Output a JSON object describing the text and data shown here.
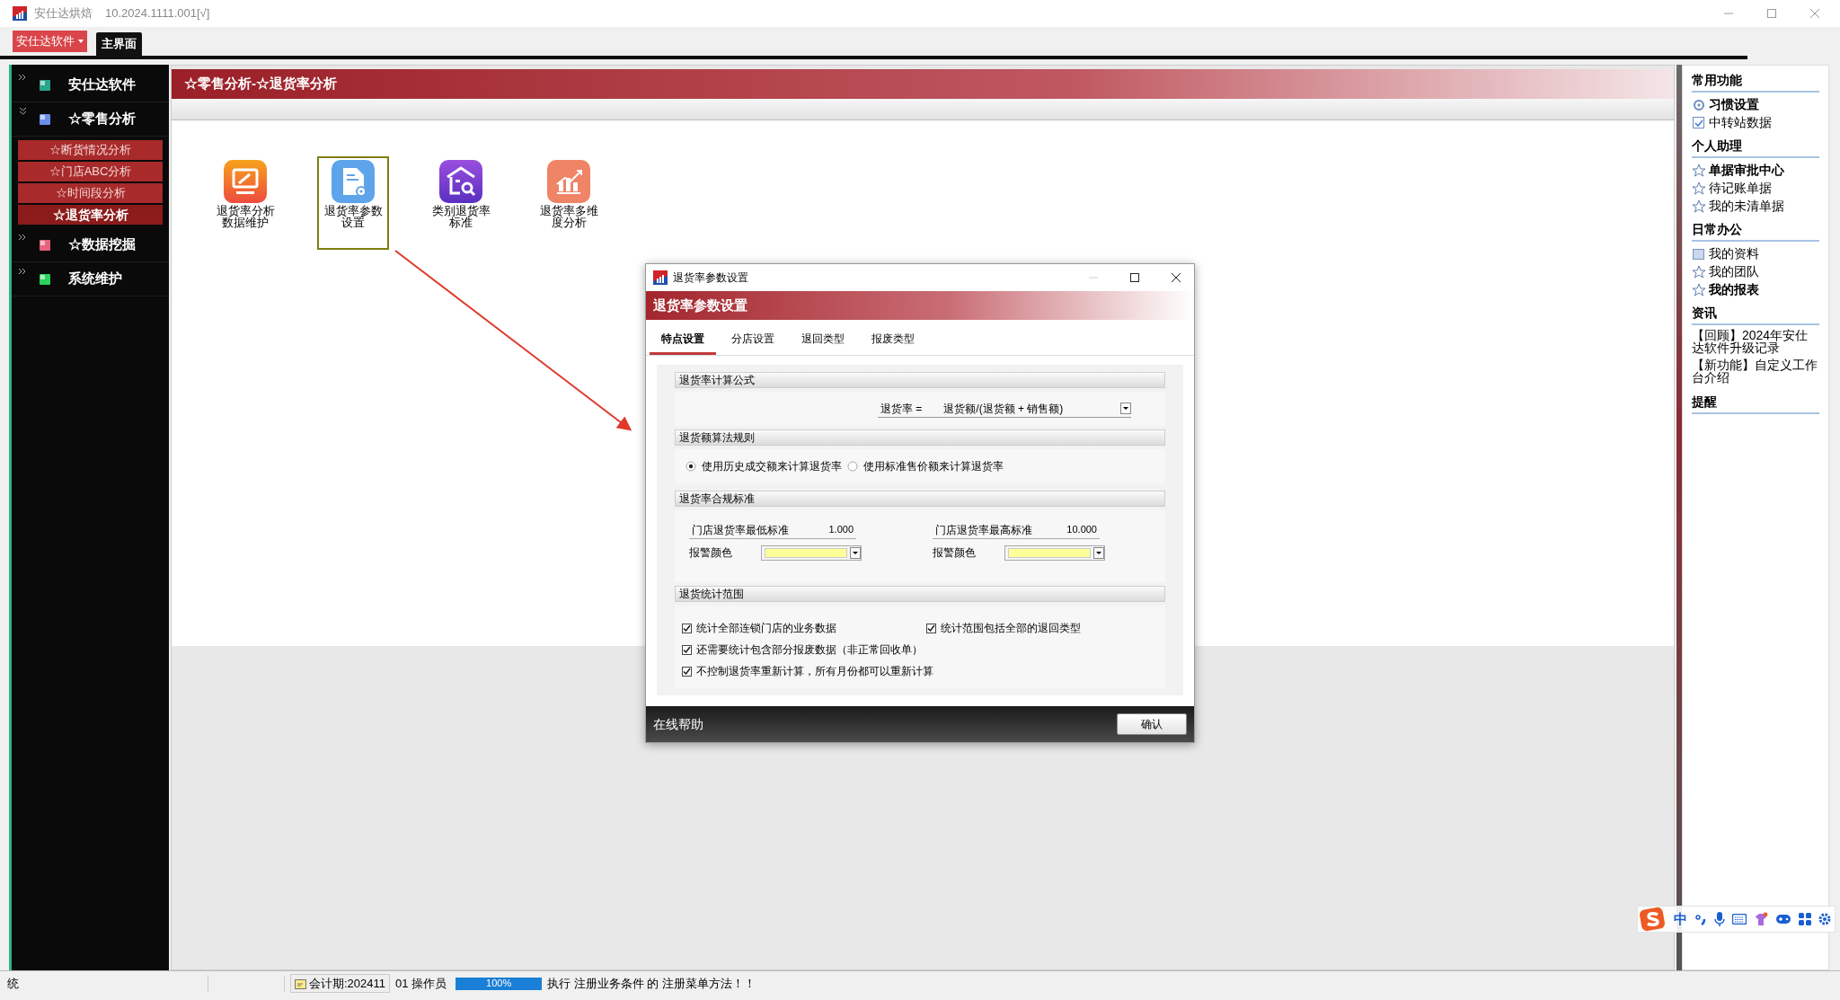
{
  "window": {
    "title": "安仕达烘焙",
    "version": "10.2024.1111.001[√]"
  },
  "menu_button": {
    "label": "安仕达软件"
  },
  "tabs": [
    {
      "label": "主界面",
      "selected": true
    }
  ],
  "sidebar": {
    "groups": [
      {
        "label": "安仕达软件",
        "expanded": false
      },
      {
        "label": "☆零售分析",
        "expanded": true,
        "children": [
          {
            "label": "☆断货情况分析",
            "selected": false
          },
          {
            "label": "☆门店ABC分析",
            "selected": false
          },
          {
            "label": "☆时间段分析",
            "selected": false
          },
          {
            "label": "☆退货率分析",
            "selected": true
          }
        ]
      },
      {
        "label": "☆数据挖掘",
        "expanded": false
      },
      {
        "label": "系统维护",
        "expanded": false
      }
    ]
  },
  "breadcrumb": "☆零售分析-☆退货率分析",
  "launchers": [
    {
      "lines": [
        "退货率分析",
        "数据维护"
      ],
      "selected": false
    },
    {
      "lines": [
        "退货率参数",
        "设置"
      ],
      "selected": true
    },
    {
      "lines": [
        "类别退货率",
        "标准"
      ],
      "selected": false
    },
    {
      "lines": [
        "退货率多维",
        "度分析"
      ],
      "selected": false
    }
  ],
  "dialog": {
    "title": "退货率参数设置",
    "header": "退货率参数设置",
    "tabs": [
      {
        "label": "特点设置",
        "selected": true
      },
      {
        "label": "分店设置",
        "selected": false
      },
      {
        "label": "退回类型",
        "selected": false
      },
      {
        "label": "报废类型",
        "selected": false
      }
    ],
    "formula": {
      "title": "退货率计算公式",
      "lhs": "退货率 =",
      "value": "退货额/(退货额 + 销售额)"
    },
    "rule": {
      "title": "退货额算法规则",
      "radios": [
        {
          "label": "使用历史成交额来计算退货率",
          "selected": true
        },
        {
          "label": "使用标准售价额来计算退货率",
          "selected": false
        }
      ]
    },
    "standard": {
      "title": "退货率合规标准",
      "limits": [
        {
          "label": "门店退货率最低标准",
          "value": "1.000",
          "alarm_label": "报警颜色",
          "color": "#ffff99"
        },
        {
          "label": "门店退货率最高标准",
          "value": "10.000",
          "alarm_label": "报警颜色",
          "color": "#ffff99"
        }
      ]
    },
    "scope": {
      "title": "退货统计范围",
      "checks": [
        {
          "label": "统计全部连锁门店的业务数据",
          "checked": true
        },
        {
          "label": "统计范围包括全部的退回类型",
          "checked": true
        },
        {
          "label": "还需要统计包含部分报废数据（非正常回收单）",
          "checked": true
        },
        {
          "label": "不控制退货率重新计算，所有月份都可以重新计算",
          "checked": true
        }
      ]
    },
    "help": "在线帮助",
    "ok": "确认"
  },
  "right_panel": {
    "sections": [
      {
        "title": "常用功能",
        "items": [
          {
            "label": "习惯设置",
            "bold": true
          },
          {
            "label": "中转站数据",
            "bold": false
          }
        ]
      },
      {
        "title": "个人助理",
        "items": [
          {
            "label": "单据审批中心",
            "bold": true
          },
          {
            "label": "待记账单据",
            "bold": false
          },
          {
            "label": "我的未清单据",
            "bold": false
          }
        ]
      },
      {
        "title": "日常办公",
        "items": [
          {
            "label": "我的资料",
            "bold": false
          },
          {
            "label": "我的团队",
            "bold": false
          },
          {
            "label": "我的报表",
            "bold": true
          }
        ]
      },
      {
        "title": "资讯",
        "news": [
          "【回顾】2024年安仕达软件升级记录",
          "【新功能】自定义工作台介绍"
        ]
      },
      {
        "title": "提醒"
      }
    ]
  },
  "status_bar": {
    "left": "统",
    "period": "会计期:202411",
    "operator": "01 操作员",
    "progress": {
      "level": 1,
      "reading": "100%"
    },
    "message": "执行 注册业务条件 的 注册菜单方法！！"
  },
  "ime": {
    "lang": "中"
  }
}
